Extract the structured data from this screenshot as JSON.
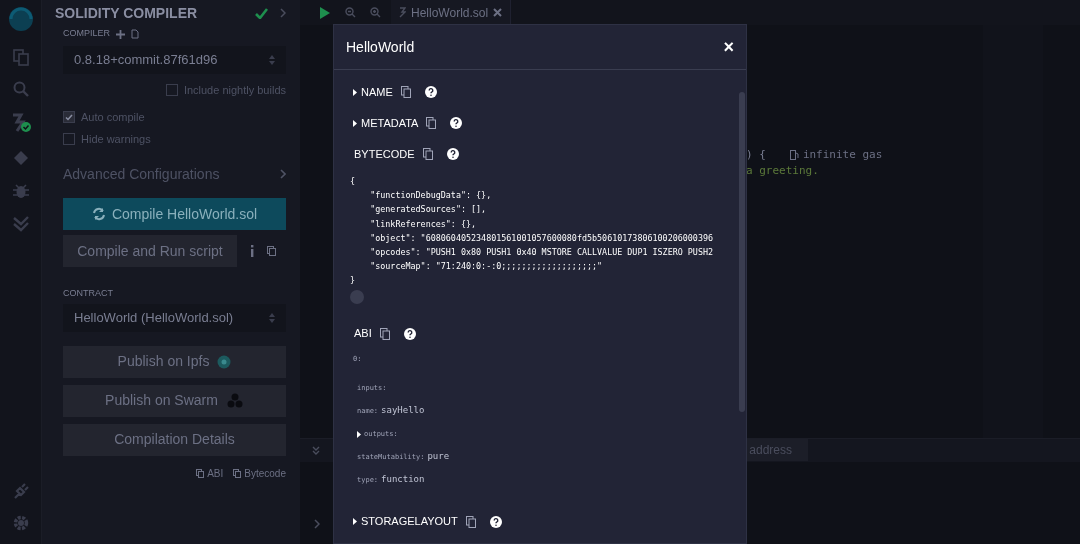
{
  "side_panel": {
    "title": "SOLIDITY COMPILER",
    "compiler_label": "COMPILER",
    "compiler_version": "0.8.18+commit.87f61d96",
    "options": [
      {
        "label": "Include nightly builds",
        "checked": false
      },
      {
        "label": "Auto compile",
        "checked": true
      },
      {
        "label": "Hide warnings",
        "checked": false
      }
    ],
    "advanced": "Advanced Configurations",
    "compile_button": "Compile HelloWorld.sol",
    "run_script_button": "Compile and Run script",
    "contract_label": "CONTRACT",
    "contract": "HelloWorld (HelloWorld.sol)",
    "actions": [
      "Publish on Ipfs",
      "Publish on Swarm",
      "Compilation Details"
    ],
    "copy_links": [
      "ABI",
      "Bytecode"
    ]
  },
  "editor": {
    "tabs": [
      {
        "label": "HelloWorld.sol",
        "selected": true
      }
    ],
    "code_fragments": [
      {
        "text": ") {",
        "kind": "code"
      },
      {
        "text": "infinite gas",
        "kind": "gas"
      },
      {
        "text": "a greeting.",
        "kind": "comment"
      }
    ],
    "terminal_button": "address"
  },
  "modal": {
    "title": "HelloWorld",
    "close": "×",
    "sections": [
      {
        "label": "NAME",
        "expanded": false
      },
      {
        "label": "METADATA",
        "expanded": false
      },
      {
        "label": "BYTECODE",
        "expanded": true,
        "kind": "code",
        "lines": [
          "{",
          "    \"functionDebugData\": {},",
          "    \"generatedSources\": [],",
          "    \"linkReferences\": {},",
          "    \"object\": \"608060405234801561001057600080fd5b50610173806100206000396",
          "    \"opcodes\": \"PUSH1 0x80 PUSH1 0x40 MSTORE CALLVALUE DUP1 ISZERO PUSH2",
          "    \"sourceMap\": \"71:240:0:-:0;;;;;;;;;;;;;;;;;;;\"",
          "}"
        ]
      },
      {
        "label": "ABI",
        "expanded": true,
        "kind": "tree",
        "index": "0:",
        "entries": [
          {
            "key": "inputs:",
            "kind": "leaf"
          },
          {
            "key": "name:",
            "value": "sayHello",
            "kind": "leaf"
          },
          {
            "key": "outputs:",
            "kind": "node",
            "expanded": false
          },
          {
            "key": "stateMutability:",
            "value": "pure",
            "kind": "leaf"
          },
          {
            "key": "type:",
            "value": "function",
            "kind": "leaf"
          }
        ]
      },
      {
        "label": "STORAGELAYOUT",
        "expanded": false
      }
    ]
  }
}
